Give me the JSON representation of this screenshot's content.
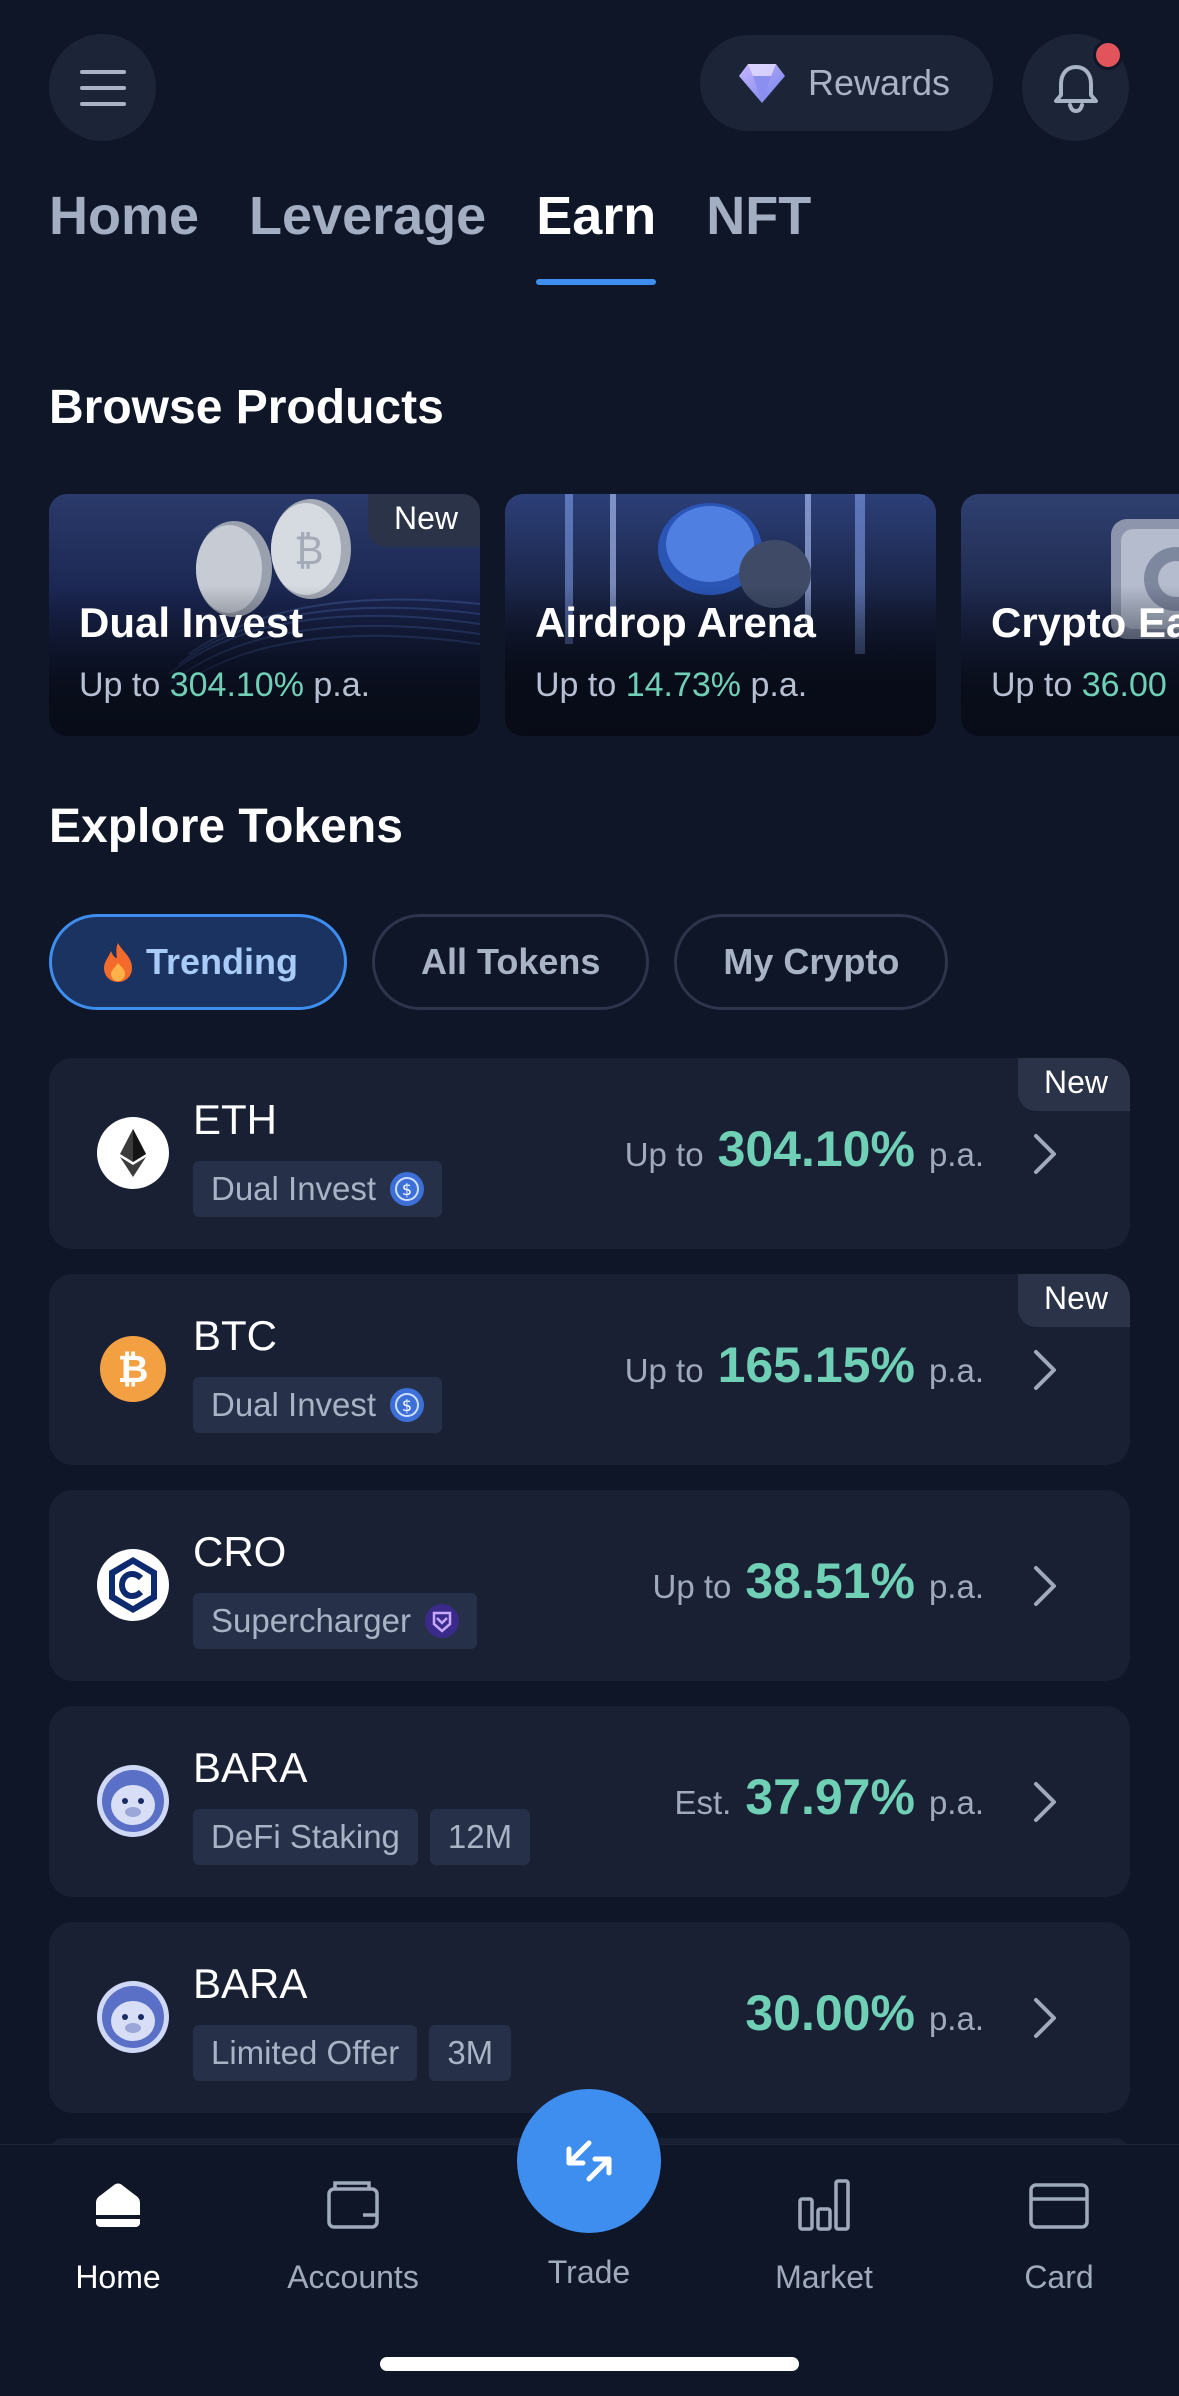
{
  "header": {
    "rewards_label": "Rewards"
  },
  "tabs": [
    {
      "label": "Home"
    },
    {
      "label": "Leverage"
    },
    {
      "label": "Earn"
    },
    {
      "label": "NFT"
    }
  ],
  "browse": {
    "title": "Browse Products",
    "cards": [
      {
        "title": "Dual Invest",
        "prefix": "Up to ",
        "rate": "304.10%",
        "suffix": " p.a.",
        "badge": "New"
      },
      {
        "title": "Airdrop Arena",
        "prefix": "Up to ",
        "rate": "14.73%",
        "suffix": " p.a."
      },
      {
        "title": "Crypto Ea",
        "prefix": "Up to ",
        "rate": "36.00",
        "suffix": ""
      }
    ]
  },
  "explore": {
    "title": "Explore Tokens",
    "filters": [
      {
        "label": "Trending"
      },
      {
        "label": "All Tokens"
      },
      {
        "label": "My Crypto"
      }
    ],
    "tokens": [
      {
        "symbol": "ETH",
        "tag": "Dual Invest",
        "prefix": "Up to",
        "rate": "304.10%",
        "suffix": "p.a.",
        "badge": "New"
      },
      {
        "symbol": "BTC",
        "tag": "Dual Invest",
        "prefix": "Up to",
        "rate": "165.15%",
        "suffix": "p.a.",
        "badge": "New"
      },
      {
        "symbol": "CRO",
        "tag": "Supercharger",
        "prefix": "Up to",
        "rate": "38.51%",
        "suffix": "p.a."
      },
      {
        "symbol": "BARA",
        "tag": "DeFi Staking",
        "tag2": "12M",
        "prefix": "Est.",
        "rate": "37.97%",
        "suffix": "p.a."
      },
      {
        "symbol": "BARA",
        "tag": "Limited Offer",
        "tag2": "3M",
        "prefix": "",
        "rate": "30.00%",
        "suffix": "p.a."
      }
    ]
  },
  "nav": {
    "home": "Home",
    "accounts": "Accounts",
    "trade": "Trade",
    "market": "Market",
    "card": "Card"
  },
  "colors": {
    "background": "#0f1628",
    "accent": "#3e8ef0",
    "rate_green": "#6fd0b6",
    "notification": "#e2545c"
  }
}
